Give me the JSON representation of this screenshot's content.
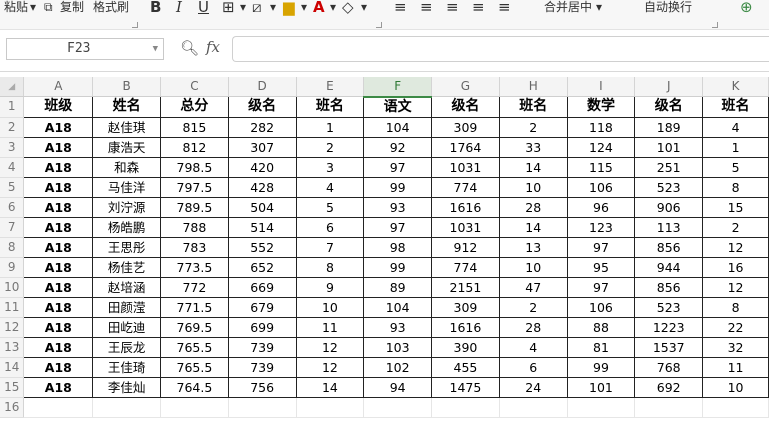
{
  "toolbar": {
    "paste": "粘贴",
    "copy": "复制",
    "format_painter": "格式刷",
    "bold": "B",
    "italic": "I",
    "underline": "U",
    "merge_center": "合并居中",
    "wrap_text": "自动换行"
  },
  "formula_bar": {
    "cell_ref": "F23",
    "fx": "fx",
    "formula": ""
  },
  "sheet": {
    "active_column": "F",
    "columns": [
      "A",
      "B",
      "C",
      "D",
      "E",
      "F",
      "G",
      "H",
      "I",
      "J",
      "K"
    ],
    "row_numbers": [
      "1",
      "2",
      "3",
      "4",
      "5",
      "6",
      "7",
      "8",
      "9",
      "10",
      "11",
      "12",
      "13",
      "14",
      "15",
      "16"
    ],
    "header": [
      "班级",
      "姓名",
      "总分",
      "级名",
      "班名",
      "语文",
      "级名",
      "班名",
      "数学",
      "级名",
      "班名"
    ],
    "rows": [
      [
        "A18",
        "赵佳琪",
        "815",
        "282",
        "1",
        "104",
        "309",
        "2",
        "118",
        "189",
        "4"
      ],
      [
        "A18",
        "康浩天",
        "812",
        "307",
        "2",
        "92",
        "1764",
        "33",
        "124",
        "101",
        "1"
      ],
      [
        "A18",
        "和森",
        "798.5",
        "420",
        "3",
        "97",
        "1031",
        "14",
        "115",
        "251",
        "5"
      ],
      [
        "A18",
        "马佳洋",
        "797.5",
        "428",
        "4",
        "99",
        "774",
        "10",
        "106",
        "523",
        "8"
      ],
      [
        "A18",
        "刘泞源",
        "789.5",
        "504",
        "5",
        "93",
        "1616",
        "28",
        "96",
        "906",
        "15"
      ],
      [
        "A18",
        "杨皓鹏",
        "788",
        "514",
        "6",
        "97",
        "1031",
        "14",
        "123",
        "113",
        "2"
      ],
      [
        "A18",
        "王思彤",
        "783",
        "552",
        "7",
        "98",
        "912",
        "13",
        "97",
        "856",
        "12"
      ],
      [
        "A18",
        "杨佳艺",
        "773.5",
        "652",
        "8",
        "99",
        "774",
        "10",
        "95",
        "944",
        "16"
      ],
      [
        "A18",
        "赵培涵",
        "772",
        "669",
        "9",
        "89",
        "2151",
        "47",
        "97",
        "856",
        "12"
      ],
      [
        "A18",
        "田颜滢",
        "771.5",
        "679",
        "10",
        "104",
        "309",
        "2",
        "106",
        "523",
        "8"
      ],
      [
        "A18",
        "田屹迪",
        "769.5",
        "699",
        "11",
        "93",
        "1616",
        "28",
        "88",
        "1223",
        "22"
      ],
      [
        "A18",
        "王辰龙",
        "765.5",
        "739",
        "12",
        "103",
        "390",
        "4",
        "81",
        "1537",
        "32"
      ],
      [
        "A18",
        "王佳琦",
        "765.5",
        "739",
        "12",
        "102",
        "455",
        "6",
        "99",
        "768",
        "11"
      ],
      [
        "A18",
        "李佳灿",
        "764.5",
        "756",
        "14",
        "94",
        "1475",
        "24",
        "101",
        "692",
        "10"
      ]
    ]
  }
}
